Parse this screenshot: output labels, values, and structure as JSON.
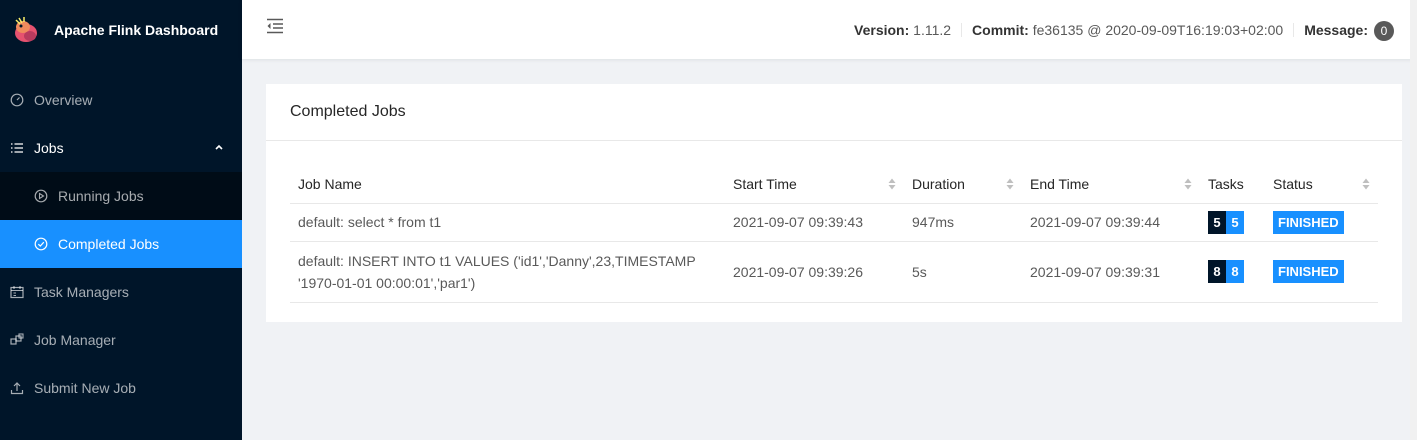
{
  "app": {
    "title": "Apache Flink Dashboard"
  },
  "sidebar": {
    "items": [
      {
        "label": "Overview",
        "icon": "dashboard-icon"
      },
      {
        "label": "Jobs",
        "icon": "list-icon"
      },
      {
        "label": "Running Jobs",
        "icon": "play-circle-icon"
      },
      {
        "label": "Completed Jobs",
        "icon": "check-circle-icon"
      },
      {
        "label": "Task Managers",
        "icon": "schedule-icon"
      },
      {
        "label": "Job Manager",
        "icon": "build-icon"
      },
      {
        "label": "Submit New Job",
        "icon": "upload-icon"
      }
    ]
  },
  "header": {
    "version_label": "Version:",
    "version_value": "1.11.2",
    "commit_label": "Commit:",
    "commit_value": "fe36135 @ 2020-09-09T16:19:03+02:00",
    "message_label": "Message:",
    "message_count": "0"
  },
  "card": {
    "title": "Completed Jobs",
    "columns": [
      "Job Name",
      "Start Time",
      "Duration",
      "End Time",
      "Tasks",
      "Status"
    ],
    "rows": [
      {
        "job_name": "default: select * from t1",
        "start_time": "2021-09-07 09:39:43",
        "duration": "947ms",
        "end_time": "2021-09-07 09:39:44",
        "tasks_total": "5",
        "tasks_finished": "5",
        "status": "FINISHED"
      },
      {
        "job_name": "default: INSERT INTO t1 VALUES ('id1','Danny',23,TIMESTAMP '1970-01-01 00:00:01','par1')",
        "start_time": "2021-09-07 09:39:26",
        "duration": "5s",
        "end_time": "2021-09-07 09:39:31",
        "tasks_total": "8",
        "tasks_finished": "8",
        "status": "FINISHED"
      }
    ]
  },
  "colors": {
    "sidebar_bg": "#001529",
    "accent": "#1890ff",
    "submenu_bg": "#000c17"
  }
}
